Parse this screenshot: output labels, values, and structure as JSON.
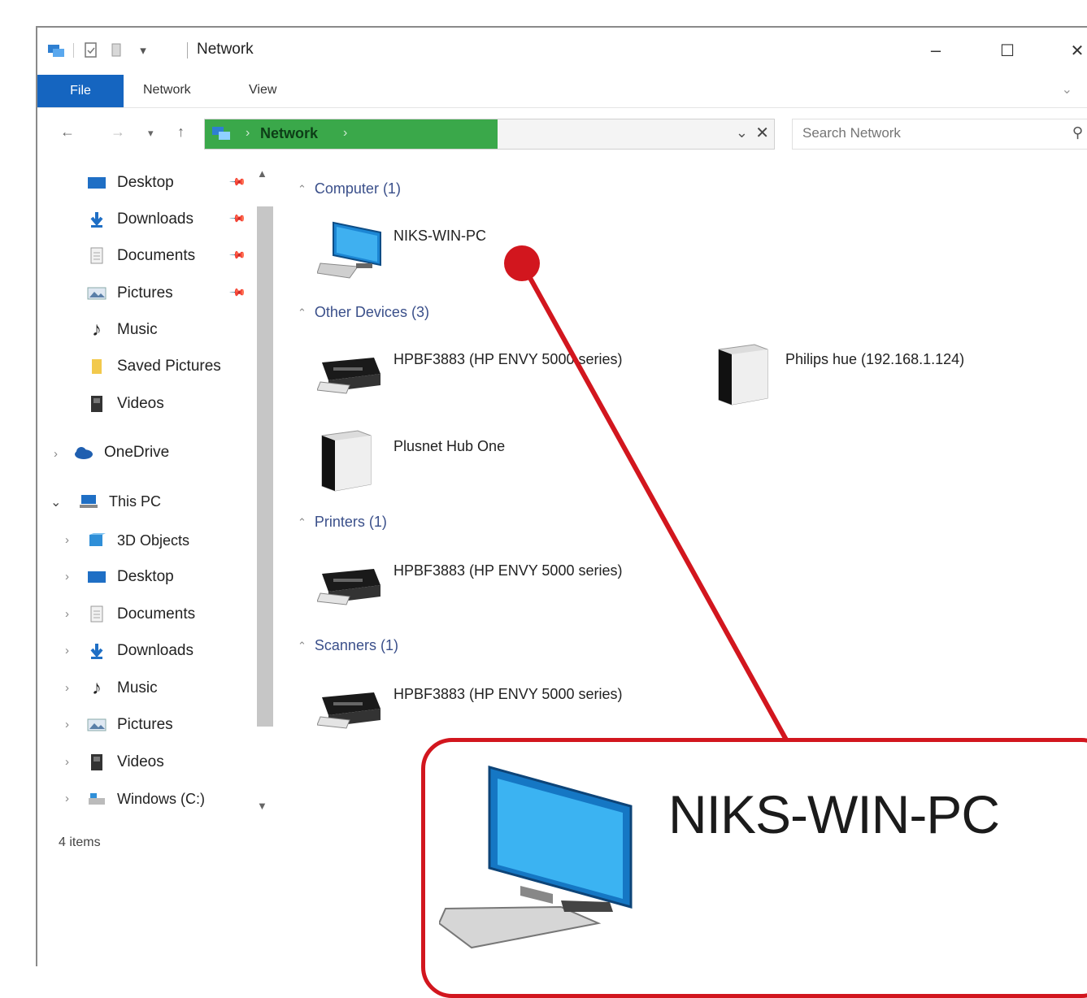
{
  "window": {
    "title": "Network",
    "minimize": "–",
    "maximize": "☐",
    "close": "✕"
  },
  "ribbon": {
    "tabs": [
      "File",
      "Network",
      "View"
    ]
  },
  "address_bar": {
    "location": "Network",
    "search_placeholder": "Search Network"
  },
  "nav_pane": {
    "quick_access": [
      {
        "label": "Desktop",
        "icon": "desktop-folder-icon",
        "pinned": true
      },
      {
        "label": "Downloads",
        "icon": "downloads-icon",
        "pinned": true
      },
      {
        "label": "Documents",
        "icon": "documents-icon",
        "pinned": true
      },
      {
        "label": "Pictures",
        "icon": "pictures-icon",
        "pinned": true
      },
      {
        "label": "Music",
        "icon": "music-icon",
        "pinned": false
      },
      {
        "label": "Saved Pictures",
        "icon": "folder-icon",
        "pinned": false
      },
      {
        "label": "Videos",
        "icon": "videos-icon",
        "pinned": false
      }
    ],
    "onedrive": "OneDrive",
    "this_pc": "This PC",
    "this_pc_items": [
      {
        "label": "3D Objects",
        "icon": "3d-objects-icon"
      },
      {
        "label": "Desktop",
        "icon": "desktop-folder-icon"
      },
      {
        "label": "Documents",
        "icon": "documents-icon"
      },
      {
        "label": "Downloads",
        "icon": "downloads-icon"
      },
      {
        "label": "Music",
        "icon": "music-icon"
      },
      {
        "label": "Pictures",
        "icon": "pictures-icon"
      },
      {
        "label": "Videos",
        "icon": "videos-icon"
      },
      {
        "label": "Windows (C:)",
        "icon": "drive-icon"
      }
    ]
  },
  "status_bar": {
    "item_count": "4 items"
  },
  "groups": [
    {
      "header": "Computer (1)",
      "items": [
        "NIKS-WIN-PC"
      ]
    },
    {
      "header": "Other Devices (3)",
      "items": [
        "HPBF3883 (HP ENVY 5000 series)",
        "Philips hue (192.168.1.124)",
        "Plusnet Hub One"
      ]
    },
    {
      "header": "Printers (1)",
      "items": [
        "HPBF3883 (HP ENVY 5000 series)"
      ]
    },
    {
      "header": "Scanners (1)",
      "items": [
        "HPBF3883 (HP ENVY 5000 series)"
      ]
    }
  ],
  "callout": {
    "label": "NIKS-WIN-PC",
    "color": "#d2161e"
  },
  "colors": {
    "file_tab": "#1565c0",
    "address_highlight": "#3aa84a",
    "group_header": "#3a4f8a"
  }
}
